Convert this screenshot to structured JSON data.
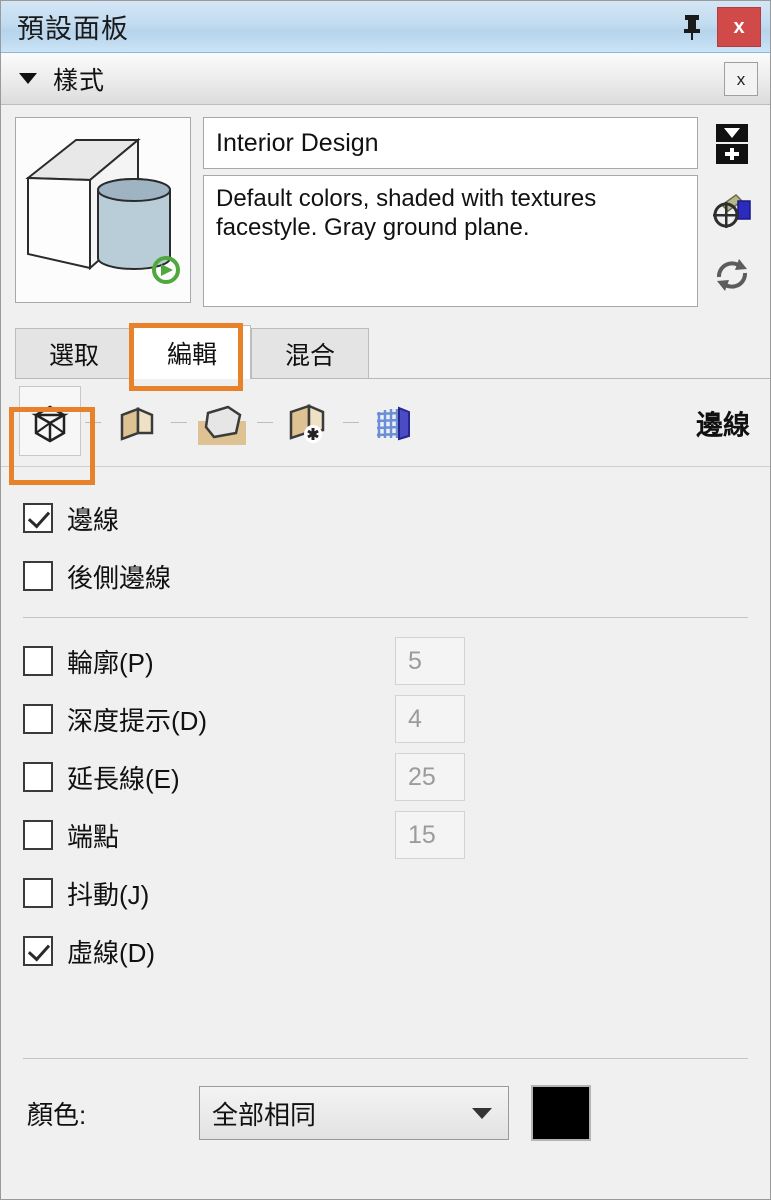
{
  "window": {
    "title": "預設面板",
    "pin_icon": "pin-icon",
    "close_label": "x"
  },
  "section": {
    "title": "樣式",
    "collapse_icon": "triangle-down-icon",
    "close_label": "x"
  },
  "style": {
    "thumbnail_icon": "style-preview-thumbnail",
    "name": "Interior Design",
    "description": "Default colors, shaded with textures facestyle. Gray ground plane.",
    "side_buttons": [
      {
        "name": "create-new-style-button",
        "icon": "new-style-icon"
      },
      {
        "name": "update-style-button",
        "icon": "paint-bucket-target-icon"
      },
      {
        "name": "refresh-style-button",
        "icon": "refresh-arrows-icon"
      }
    ]
  },
  "tabs": [
    {
      "label": "選取",
      "name": "tab-select",
      "active": false
    },
    {
      "label": "編輯",
      "name": "tab-edit",
      "active": true
    },
    {
      "label": "混合",
      "name": "tab-mix",
      "active": false
    }
  ],
  "toolbar": {
    "heading": "邊線",
    "icons": [
      {
        "name": "edge-settings-icon",
        "label": "edge-settings",
        "selected": true
      },
      {
        "name": "face-settings-icon",
        "label": "face-settings",
        "selected": false
      },
      {
        "name": "background-settings-icon",
        "label": "background-settings",
        "selected": false
      },
      {
        "name": "watermark-settings-icon",
        "label": "watermark-settings",
        "selected": false
      },
      {
        "name": "modeling-settings-icon",
        "label": "modeling-settings",
        "selected": false
      }
    ]
  },
  "options": {
    "group1": [
      {
        "label": "邊線",
        "checked": true,
        "value": null
      },
      {
        "label": "後側邊線",
        "checked": false,
        "value": null
      }
    ],
    "group2": [
      {
        "label": "輪廓(P)",
        "checked": false,
        "value": "5"
      },
      {
        "label": "深度提示(D)",
        "checked": false,
        "value": "4"
      },
      {
        "label": "延長線(E)",
        "checked": false,
        "value": "25"
      },
      {
        "label": "端點",
        "checked": false,
        "value": "15"
      },
      {
        "label": "抖動(J)",
        "checked": false,
        "value": null
      },
      {
        "label": "虛線(D)",
        "checked": true,
        "value": null
      }
    ]
  },
  "color": {
    "label": "顏色:",
    "selected_option": "全部相同",
    "swatch_hex": "#000000"
  },
  "annotations": [
    {
      "name": "highlight-tab-edit",
      "color": "#e8822a"
    },
    {
      "name": "highlight-edge-settings-icon",
      "color": "#e8822a"
    }
  ]
}
